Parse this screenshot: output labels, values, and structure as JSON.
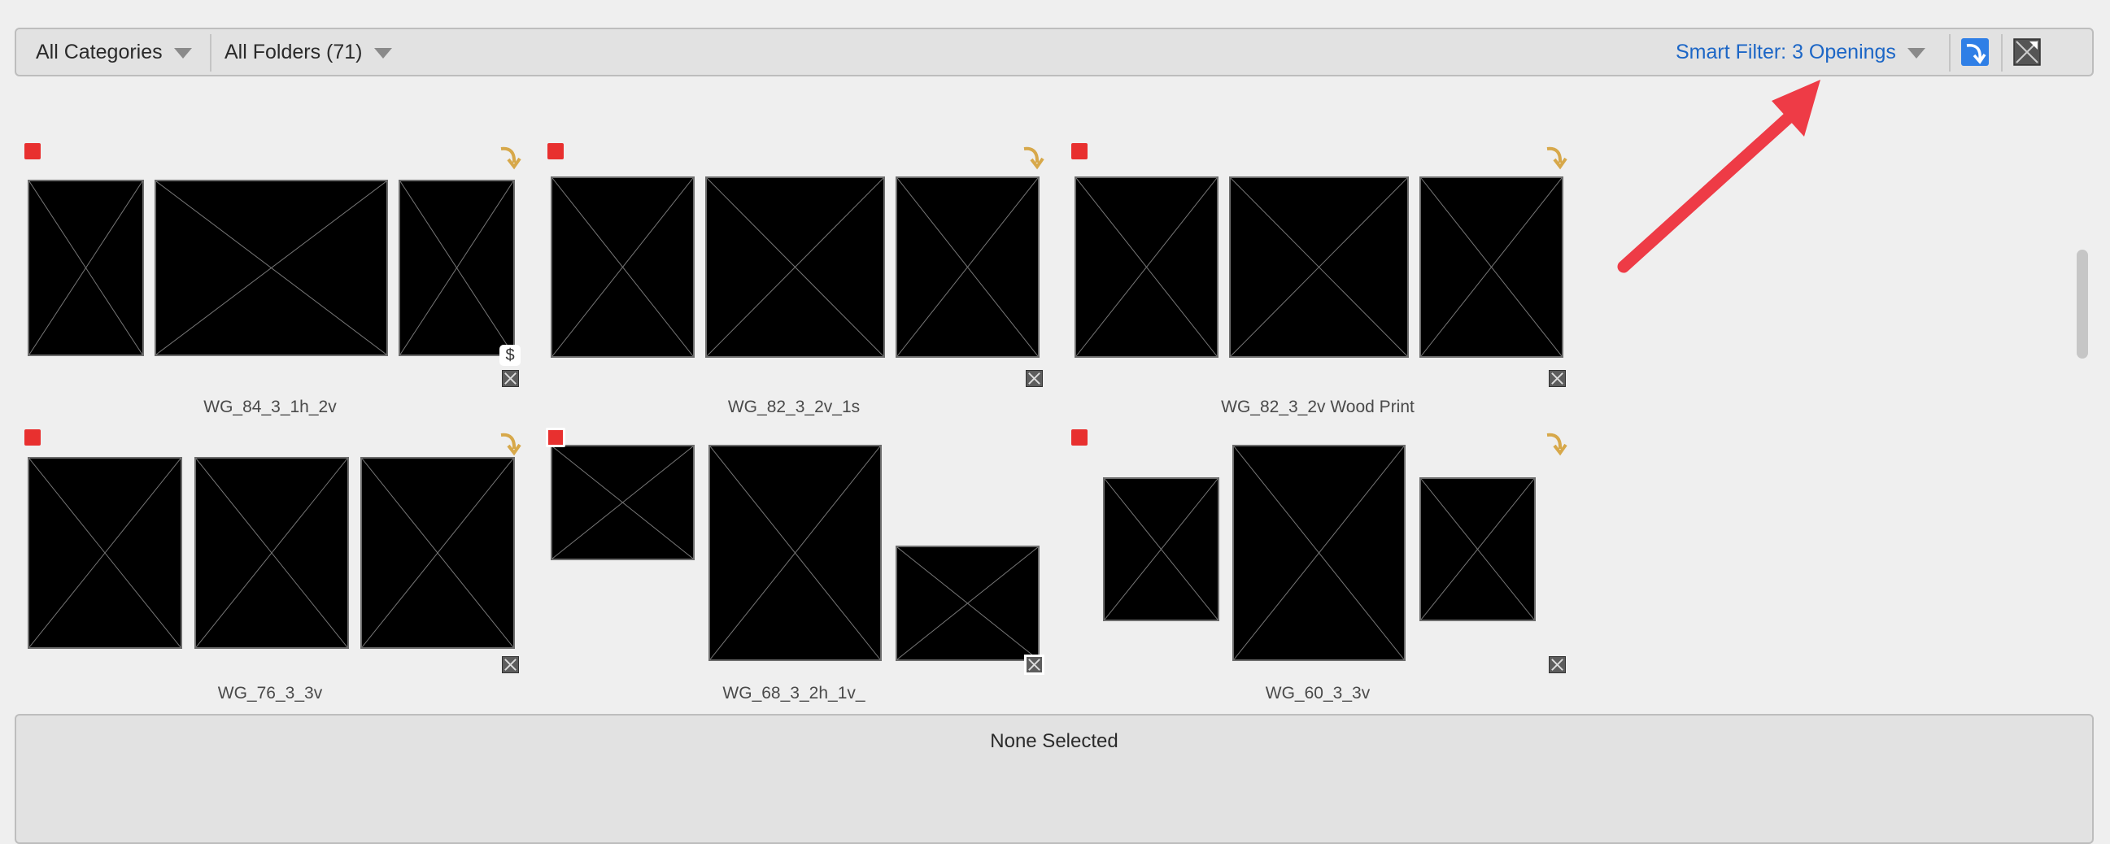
{
  "toolbar": {
    "category": "All Categories",
    "folder": "All Folders (71)",
    "smart_filter": "Smart Filter: 3 Openings",
    "accent": "#1c66c6"
  },
  "grid": {
    "tiles": [
      {
        "name": "WG_84_3_1h_2v",
        "rotated": true,
        "price": "$"
      },
      {
        "name": "WG_82_3_2v_1s",
        "rotated": true
      },
      {
        "name": "WG_82_3_2v Wood Print",
        "rotated": true
      },
      {
        "name": "WG_76_3_3v",
        "rotated": true
      },
      {
        "name": "WG_68_3_2h_1v_",
        "rotated": false
      },
      {
        "name": "WG_60_3_3v",
        "rotated": true
      }
    ]
  },
  "details": {
    "status": "None Selected"
  },
  "icons": {
    "flag": "red-flag",
    "rotate": "rotate-arrow-icon",
    "clear": "clear-filter-icon",
    "placeholder": "x-placeholder-icon"
  },
  "colors": {
    "flag": "#e8302f",
    "rotate": "#d7a84a",
    "annotation_arrow": "#ee3b46"
  }
}
